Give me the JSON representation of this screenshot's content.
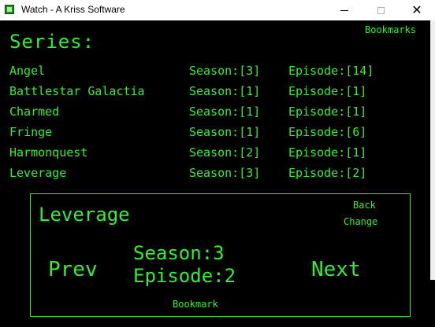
{
  "window": {
    "title": "Watch - A Kriss Software",
    "minimize_icon": "minimize-icon",
    "maximize_icon": "maximize-icon",
    "close_glyph": "✕"
  },
  "header": {
    "title": "Series:",
    "bookmarks_label": "Bookmarks"
  },
  "series": [
    {
      "name": "Angel",
      "season": "Season:[3]",
      "episode": "Episode:[14]"
    },
    {
      "name": "Battlestar Galactia",
      "season": "Season:[1]",
      "episode": "Episode:[1]"
    },
    {
      "name": "Charmed",
      "season": "Season:[1]",
      "episode": "Episode:[1]"
    },
    {
      "name": "Fringe",
      "season": "Season:[1]",
      "episode": "Episode:[6]"
    },
    {
      "name": "Harmonquest",
      "season": "Season:[2]",
      "episode": "Episode:[1]"
    },
    {
      "name": "Leverage",
      "season": "Season:[3]",
      "episode": "Episode:[2]"
    }
  ],
  "detail": {
    "title": "Leverage",
    "back_label": "Back",
    "change_label": "Change",
    "prev_label": "Prev",
    "next_label": "Next",
    "season_text": "Season:3",
    "episode_text": "Episode:2",
    "bookmark_label": "Bookmark"
  },
  "colors": {
    "background": "#000000",
    "text": "#33ee33"
  }
}
